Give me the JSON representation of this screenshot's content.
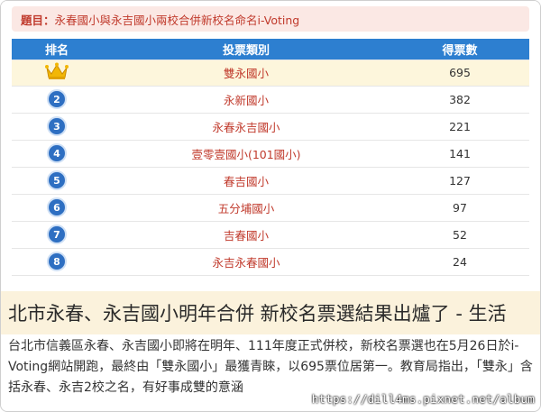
{
  "poll": {
    "title_label": "題目：",
    "title_text": "永春國小與永吉國小兩校合併新校名命名i-Voting",
    "headers": {
      "rank": "排名",
      "category": "投票類別",
      "votes": "得票數"
    },
    "rows": [
      {
        "rank": "1",
        "name": "雙永國小",
        "votes": "695",
        "crown": true
      },
      {
        "rank": "2",
        "name": "永新國小",
        "votes": "382"
      },
      {
        "rank": "3",
        "name": "永春永吉國小",
        "votes": "221"
      },
      {
        "rank": "4",
        "name": "壹零壹國小(101國小)",
        "votes": "141"
      },
      {
        "rank": "5",
        "name": "春吉國小",
        "votes": "127"
      },
      {
        "rank": "6",
        "name": "五分埔國小",
        "votes": "97"
      },
      {
        "rank": "7",
        "name": "吉春國小",
        "votes": "52"
      },
      {
        "rank": "8",
        "name": "永吉永春國小",
        "votes": "24"
      }
    ]
  },
  "article": {
    "headline": "北市永春、永吉國小明年合併 新校名票選結果出爐了 - 生活",
    "body": "台北市信義區永春、永吉國小即將在明年、111年度正式併校，新校名票選也在5月26日於i-Voting網站開跑，最終由「雙永國小」最獲青睞，以695票位居第一。教育局指出，「雙永」含括永春、永吉2校之名，有好事成雙的意涵"
  },
  "watermark": "https://dill4ms.pixnet.net/album",
  "colors": {
    "header_blue": "#2d7fd0",
    "rank_circle": "#2e6fc2",
    "name_red": "#c0392b",
    "title_bg": "#fbe8e4",
    "winner_row_bg": "#fdf6dc",
    "headline_bg": "#fbf2dc"
  },
  "icons": {
    "winner": "crown-icon"
  }
}
